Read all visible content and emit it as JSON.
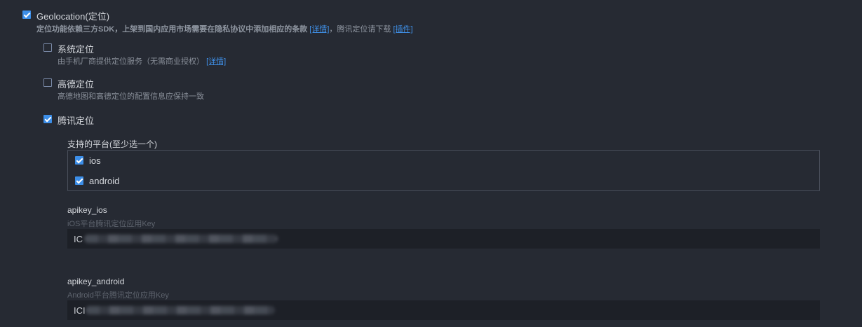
{
  "geolocation": {
    "label": "Geolocation(定位)",
    "checked": true,
    "desc_text": "定位功能依赖三方SDK，上架到国内应用市场需要在隐私协议中添加相应的条款",
    "details_link": "[详情]",
    "desc_mid": "，腾讯定位请下载",
    "plugin_link": "[插件]"
  },
  "system_location": {
    "label": "系统定位",
    "checked": false,
    "desc": "由手机厂商提供定位服务（无需商业授权）",
    "details_link": "[详情]"
  },
  "amap_location": {
    "label": "高德定位",
    "checked": false,
    "desc": "高德地图和高德定位的配置信息应保持一致"
  },
  "tencent_location": {
    "label": "腾讯定位",
    "checked": true,
    "platforms_label": "支持的平台(至少选一个)",
    "platforms": [
      {
        "label": "ios",
        "checked": true
      },
      {
        "label": "android",
        "checked": true
      }
    ],
    "apikey_ios": {
      "label": "apikey_ios",
      "desc": "iOS平台腾讯定位应用Key",
      "value_prefix": "IC"
    },
    "apikey_android": {
      "label": "apikey_android",
      "desc": "Android平台腾讯定位应用Key",
      "value_prefix": "ICI"
    }
  },
  "colors": {
    "background": "#262a33",
    "accent": "#3c8ee8",
    "link": "#3f8fe6",
    "field_bg": "#1d2027"
  }
}
